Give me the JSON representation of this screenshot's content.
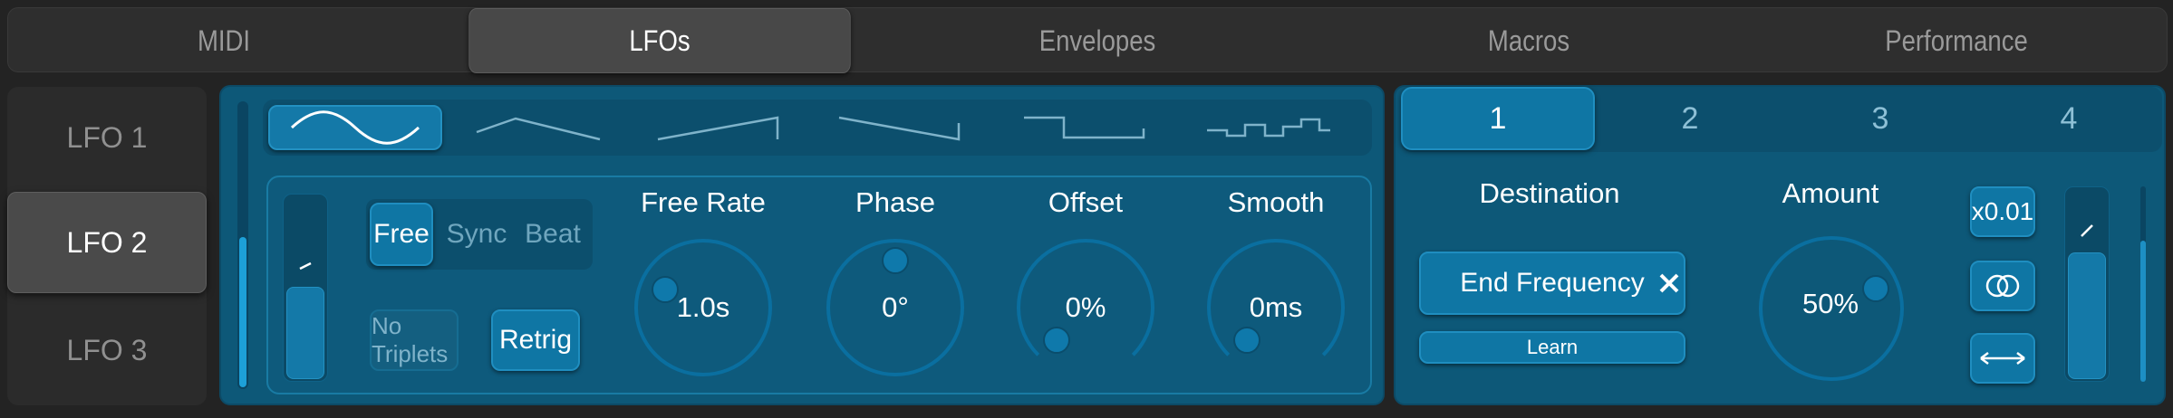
{
  "tabs": [
    {
      "label": "MIDI"
    },
    {
      "label": "LFOs"
    },
    {
      "label": "Envelopes"
    },
    {
      "label": "Macros"
    },
    {
      "label": "Performance"
    }
  ],
  "active_tab": "LFOs",
  "lfos": [
    {
      "label": "LFO 1"
    },
    {
      "label": "LFO 2"
    },
    {
      "label": "LFO 3"
    }
  ],
  "active_lfo": "LFO 2",
  "shapes": [
    "sine-wave-icon",
    "triangle-wave-icon",
    "saw-up-wave-icon",
    "saw-down-wave-icon",
    "square-wave-icon",
    "random-steps-wave-icon"
  ],
  "mode": {
    "options": [
      "Free",
      "Sync",
      "Beat"
    ],
    "active": "Free"
  },
  "no_triplets_label": "No Triplets",
  "retrig_label": "Retrig",
  "knobs": [
    {
      "label": "Free Rate",
      "value": "1.0s"
    },
    {
      "label": "Phase",
      "value": "0°"
    },
    {
      "label": "Offset",
      "value": "0%"
    },
    {
      "label": "Smooth",
      "value": "0ms"
    }
  ],
  "mod_slots": [
    {
      "label": "1"
    },
    {
      "label": "2"
    },
    {
      "label": "3"
    },
    {
      "label": "4"
    }
  ],
  "active_slot": "1",
  "destination": {
    "title": "Destination",
    "value": "End Frequency",
    "clear_icon": "close-icon",
    "learn_label": "Learn"
  },
  "amount": {
    "title": "Amount",
    "value": "50%"
  },
  "scale_label": "x0.01",
  "icons": {
    "bipolar": "overlap-circles-icon",
    "range": "double-arrow-icon",
    "curve": "curve-icon"
  },
  "colors": {
    "accent": "#0f76a4",
    "panel": "#0d5878",
    "knob_ring": "#0a6fa0"
  }
}
